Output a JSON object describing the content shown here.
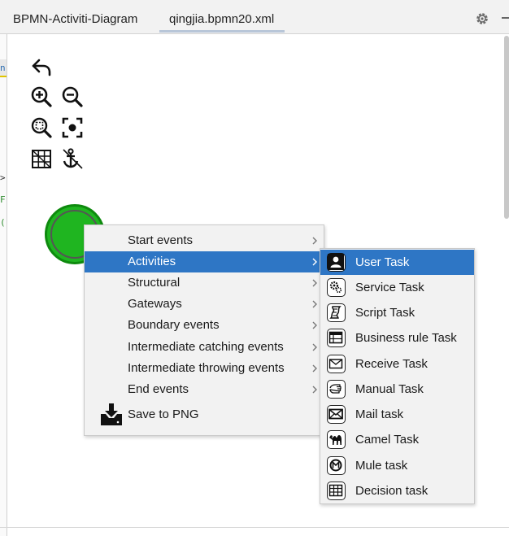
{
  "tabs": [
    {
      "label": "BPMN-Activiti-Diagram"
    },
    {
      "label": "qingjia.bpmn20.xml"
    }
  ],
  "tabbar_icons": [
    "gear-icon",
    "minimize-icon"
  ],
  "toolbar": {
    "icons": [
      "undo-icon",
      "zoom-in-icon",
      "zoom-out-icon",
      "zoom-fit-icon",
      "center-focus-icon",
      "grid-icon",
      "anchor-icon"
    ]
  },
  "left_edge_fragments": [
    "n",
    ">",
    "F",
    "("
  ],
  "canvas": {
    "start_event": {
      "color": "#1fb520"
    }
  },
  "context_menu": {
    "items": [
      {
        "label": "Start events",
        "submenu": true
      },
      {
        "label": "Activities",
        "submenu": true,
        "selected": true
      },
      {
        "label": "Structural",
        "submenu": true
      },
      {
        "label": "Gateways",
        "submenu": true
      },
      {
        "label": "Boundary events",
        "submenu": true
      },
      {
        "label": "Intermediate catching events",
        "submenu": true
      },
      {
        "label": "Intermediate throwing events",
        "submenu": true
      },
      {
        "label": "End events",
        "submenu": true
      },
      {
        "label": "Save to PNG",
        "icon": "save-download-icon"
      }
    ]
  },
  "activities_submenu": {
    "items": [
      {
        "label": "User Task",
        "icon": "user-task-icon",
        "selected": true
      },
      {
        "label": "Service Task",
        "icon": "service-task-icon"
      },
      {
        "label": "Script Task",
        "icon": "script-task-icon"
      },
      {
        "label": "Business rule Task",
        "icon": "business-rule-task-icon"
      },
      {
        "label": "Receive Task",
        "icon": "receive-task-icon"
      },
      {
        "label": "Manual Task",
        "icon": "manual-task-icon"
      },
      {
        "label": "Mail task",
        "icon": "mail-task-icon"
      },
      {
        "label": "Camel Task",
        "icon": "camel-task-icon"
      },
      {
        "label": "Mule task",
        "icon": "mule-task-icon"
      },
      {
        "label": "Decision task",
        "icon": "decision-task-icon"
      }
    ]
  },
  "colors": {
    "selection": "#2e76c5",
    "menu_bg": "#f2f2f2",
    "start_event_fill": "#1fb520"
  }
}
